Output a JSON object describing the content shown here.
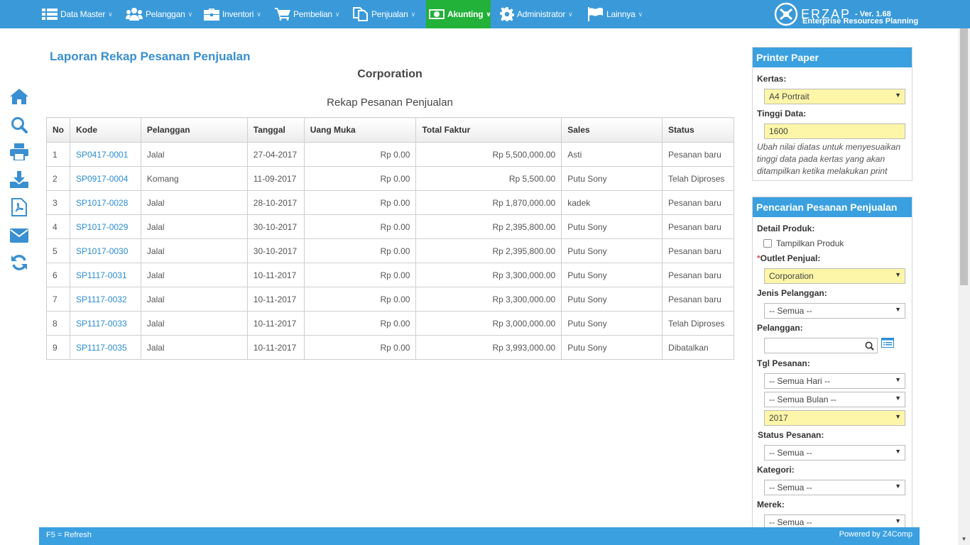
{
  "nav": {
    "items": [
      {
        "label": "Data Master",
        "icon": "list-icon"
      },
      {
        "label": "Pelanggan",
        "icon": "users-icon"
      },
      {
        "label": "Inventori",
        "icon": "briefcase-icon"
      },
      {
        "label": "Pembelian",
        "icon": "cart-icon"
      },
      {
        "label": "Penjualan",
        "icon": "documents-icon"
      },
      {
        "label": "Akunting",
        "icon": "money-icon",
        "active": true
      },
      {
        "label": "Administrator",
        "icon": "gear-icon"
      },
      {
        "label": "Lainnya",
        "icon": "flag-icon"
      }
    ],
    "brand": {
      "name": "ERZAP",
      "version": "- Ver. 1.68",
      "subtitle": "Enterprise Resources Planning"
    },
    "active_color": "#22b139",
    "bar_color": "#3a9ad9"
  },
  "sidebar_icons": [
    "home-icon",
    "search-icon",
    "print-icon",
    "download-icon",
    "pdf-icon",
    "email-icon",
    "refresh-icon"
  ],
  "page": {
    "title": "Laporan Rekap Pesanan Penjualan",
    "organization": "Corporation",
    "report_title": "Rekap Pesanan Penjualan"
  },
  "table": {
    "headers": [
      "No",
      "Kode",
      "Pelanggan",
      "Tanggal",
      "Uang Muka",
      "Total Faktur",
      "Sales",
      "Status"
    ],
    "rows": [
      [
        "1",
        "SP0417-0001",
        "Jalal",
        "27-04-2017",
        "Rp 0.00",
        "Rp 5,500,000.00",
        "Asti",
        "Pesanan baru"
      ],
      [
        "2",
        "SP0917-0004",
        "Komang",
        "11-09-2017",
        "Rp 0.00",
        "Rp 5,500.00",
        "Putu Sony",
        "Telah Diproses"
      ],
      [
        "3",
        "SP1017-0028",
        "Jalal",
        "28-10-2017",
        "Rp 0.00",
        "Rp 1,870,000.00",
        "kadek",
        "Pesanan baru"
      ],
      [
        "4",
        "SP1017-0029",
        "Jalal",
        "30-10-2017",
        "Rp 0.00",
        "Rp 2,395,800.00",
        "Putu Sony",
        "Pesanan baru"
      ],
      [
        "5",
        "SP1017-0030",
        "Jalal",
        "30-10-2017",
        "Rp 0.00",
        "Rp 2,395,800.00",
        "Putu Sony",
        "Pesanan baru"
      ],
      [
        "6",
        "SP1117-0031",
        "Jalal",
        "10-11-2017",
        "Rp 0.00",
        "Rp 3,300,000.00",
        "Putu Sony",
        "Pesanan baru"
      ],
      [
        "7",
        "SP1117-0032",
        "Jalal",
        "10-11-2017",
        "Rp 0.00",
        "Rp 3,300,000.00",
        "Putu Sony",
        "Pesanan baru"
      ],
      [
        "8",
        "SP1117-0033",
        "Jalal",
        "10-11-2017",
        "Rp 0.00",
        "Rp 3,000,000.00",
        "Putu Sony",
        "Telah Diproses"
      ],
      [
        "9",
        "SP1117-0035",
        "Jalal",
        "10-11-2017",
        "Rp 0.00",
        "Rp 3,993,000.00",
        "Putu Sony",
        "Dibatalkan"
      ]
    ]
  },
  "printer_panel": {
    "title": "Printer Paper",
    "kertas_label": "Kertas:",
    "kertas_value": "A4 Portrait",
    "tinggi_label": "Tinggi Data:",
    "tinggi_value": "1600",
    "help": "Ubah nilai diatas untuk menyesuaikan tinggi data pada kertas yang akan ditampilkan ketika melakukan print"
  },
  "search_panel": {
    "title": "Pencarian Pesanan Penjualan",
    "detail_label": "Detail Produk:",
    "tampilkan_label": "Tampilkan Produk",
    "tampilkan_checked": false,
    "outlet_label": "Outlet Penjual:",
    "outlet_required": "*",
    "outlet_value": "Corporation",
    "jenis_label": "Jenis Pelanggan:",
    "jenis_value": "-- Semua --",
    "pelanggan_label": "Pelanggan:",
    "pelanggan_value": "",
    "tgl_label": "Tgl Pesanan:",
    "hari_value": "-- Semua Hari --",
    "bulan_value": "-- Semua Bulan --",
    "tahun_value": "2017",
    "status_label": "Status Pesanan:",
    "status_value": "-- Semua --",
    "kategori_label": "Kategori:",
    "kategori_value": "-- Semua --",
    "merek_label": "Merek:",
    "merek_value": "-- Semua --"
  },
  "footer": {
    "left": "F5 = Refresh",
    "right": "Powered by Z4Comp"
  }
}
